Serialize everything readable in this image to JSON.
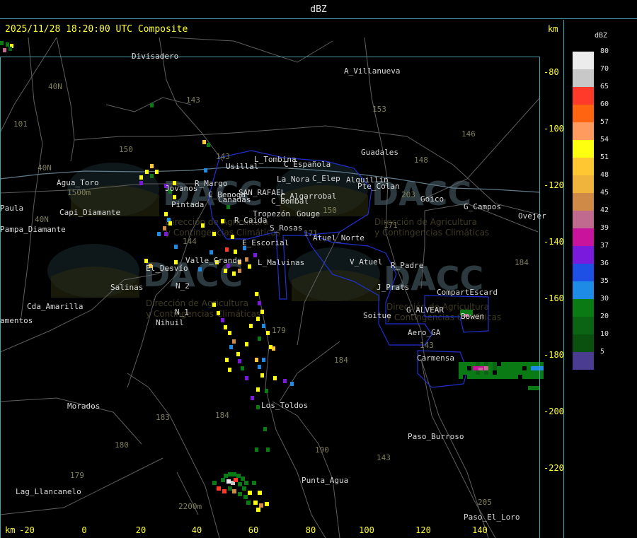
{
  "header": {
    "title": "dBZ"
  },
  "map": {
    "timestamp": "2025/11/28 18:20:00 UTC Composite",
    "unit_right": "km",
    "unit_bottom": "km",
    "y_ticks": [
      "-80",
      "-100",
      "-120",
      "-140",
      "-160",
      "-180",
      "-200",
      "-220"
    ],
    "x_ticks": [
      "-20",
      "0",
      "20",
      "40",
      "60",
      "80",
      "100",
      "120",
      "140"
    ],
    "places": [
      "Divisadero",
      "A_Villanueva",
      "Usillal",
      "L_Tombina",
      "C_Española",
      "La_Nora",
      "C_Elep",
      "Alquillín",
      "Agua_Toro",
      "Pampa_Diamante",
      "Paula",
      "Capi_Diamante",
      "Pintada",
      "Jovanos",
      "R_Margo",
      "SAN_RAFAEL",
      "C_Benoga",
      "Cañadas",
      "C_Algarrobal",
      "C_Bombal",
      "Tropezón",
      "Gouge",
      "R_Caída",
      "S_Rosas",
      "Atuel_Norte",
      "E_Escorial",
      "Valle_Grande",
      "L_Malvinas",
      "El_Desvío",
      "Salinas",
      "N_2",
      "N_1",
      "Nihuil",
      "Cda_Amarilla",
      "amentos",
      "Los_Toldos",
      "Morados",
      "Lag_Llancanelo",
      "Punta_Agua",
      "V_Atuel",
      "R_Padre",
      "J_Prats",
      "CompartEscard",
      "G_ALVEAR",
      "Soitue",
      "Aero_GA",
      "Bowen",
      "Carmensa",
      "Paso_Burroso",
      "Paso_El_Loro",
      "Guadales",
      "Goico",
      "G_Campos",
      "Ovejer",
      "Pte_Colan"
    ],
    "routes": [
      "40N",
      "40N",
      "40N",
      "101",
      "143",
      "153",
      "150",
      "146",
      "143",
      "148",
      "203",
      "171",
      "171",
      "150",
      "179",
      "184",
      "184",
      "180",
      "183",
      "179",
      "190",
      "143",
      "143",
      "205",
      "184",
      "1500m",
      "2200m",
      "144"
    ],
    "watermark": {
      "brand": "DACC",
      "line1": "Dirección de Agricultura",
      "line2": "y Contingencias Climáticas"
    }
  },
  "legend": {
    "title": "dBZ",
    "levels": [
      {
        "label": "80",
        "color": "#ececec"
      },
      {
        "label": "70",
        "color": "#c8c8c8"
      },
      {
        "label": "65",
        "color": "#ff3a2a"
      },
      {
        "label": "60",
        "color": "#ff6410"
      },
      {
        "label": "57",
        "color": "#ff9b5e"
      },
      {
        "label": "54",
        "color": "#ffff10"
      },
      {
        "label": "51",
        "color": "#ffc832"
      },
      {
        "label": "48",
        "color": "#f0b43c"
      },
      {
        "label": "45",
        "color": "#d08a48"
      },
      {
        "label": "42",
        "color": "#c06a90"
      },
      {
        "label": "39",
        "color": "#c8149c"
      },
      {
        "label": "37",
        "color": "#7a1adc"
      },
      {
        "label": "36",
        "color": "#1e50e6"
      },
      {
        "label": "35",
        "color": "#1e8ce6"
      },
      {
        "label": "30",
        "color": "#0a7a14"
      },
      {
        "label": "20",
        "color": "#0a6414"
      },
      {
        "label": "10",
        "color": "#0a500f"
      },
      {
        "label": "5",
        "color": "#4a3c90"
      }
    ]
  }
}
